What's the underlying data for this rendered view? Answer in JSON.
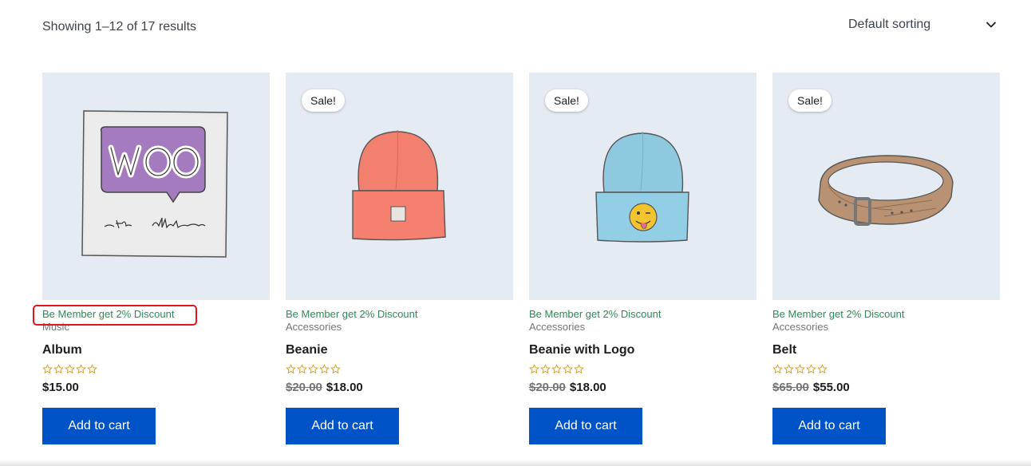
{
  "toolbar": {
    "result_count": "Showing 1–12 of 17 results",
    "sorting_selected": "Default sorting"
  },
  "products": [
    {
      "promo": "Be Member get 2% Discount",
      "category": "Music",
      "title": "Album",
      "rating": 0,
      "price_regular": "",
      "price": "$15.00",
      "sale_badge": "",
      "button": "Add to cart",
      "image_icon": "woo-album-icon"
    },
    {
      "promo": "Be Member get 2% Discount",
      "category": "Accessories",
      "title": "Beanie",
      "rating": 0,
      "price_regular": "$20.00",
      "price": "$18.00",
      "sale_badge": "Sale!",
      "button": "Add to cart",
      "image_icon": "beanie-icon"
    },
    {
      "promo": "Be Member get 2% Discount",
      "category": "Accessories",
      "title": "Beanie with Logo",
      "rating": 0,
      "price_regular": "$20.00",
      "price": "$18.00",
      "sale_badge": "Sale!",
      "button": "Add to cart",
      "image_icon": "beanie-with-logo-icon"
    },
    {
      "promo": "Be Member get 2% Discount",
      "category": "Accessories",
      "title": "Belt",
      "rating": 0,
      "price_regular": "$65.00",
      "price": "$55.00",
      "sale_badge": "Sale!",
      "button": "Add to cart",
      "image_icon": "belt-icon"
    }
  ],
  "colors": {
    "button": "#0053c7",
    "promo_text": "#2a8c55",
    "star": "#d4a12e",
    "highlight": "#e0161d",
    "thumb_bg": "#e4ebf2"
  }
}
